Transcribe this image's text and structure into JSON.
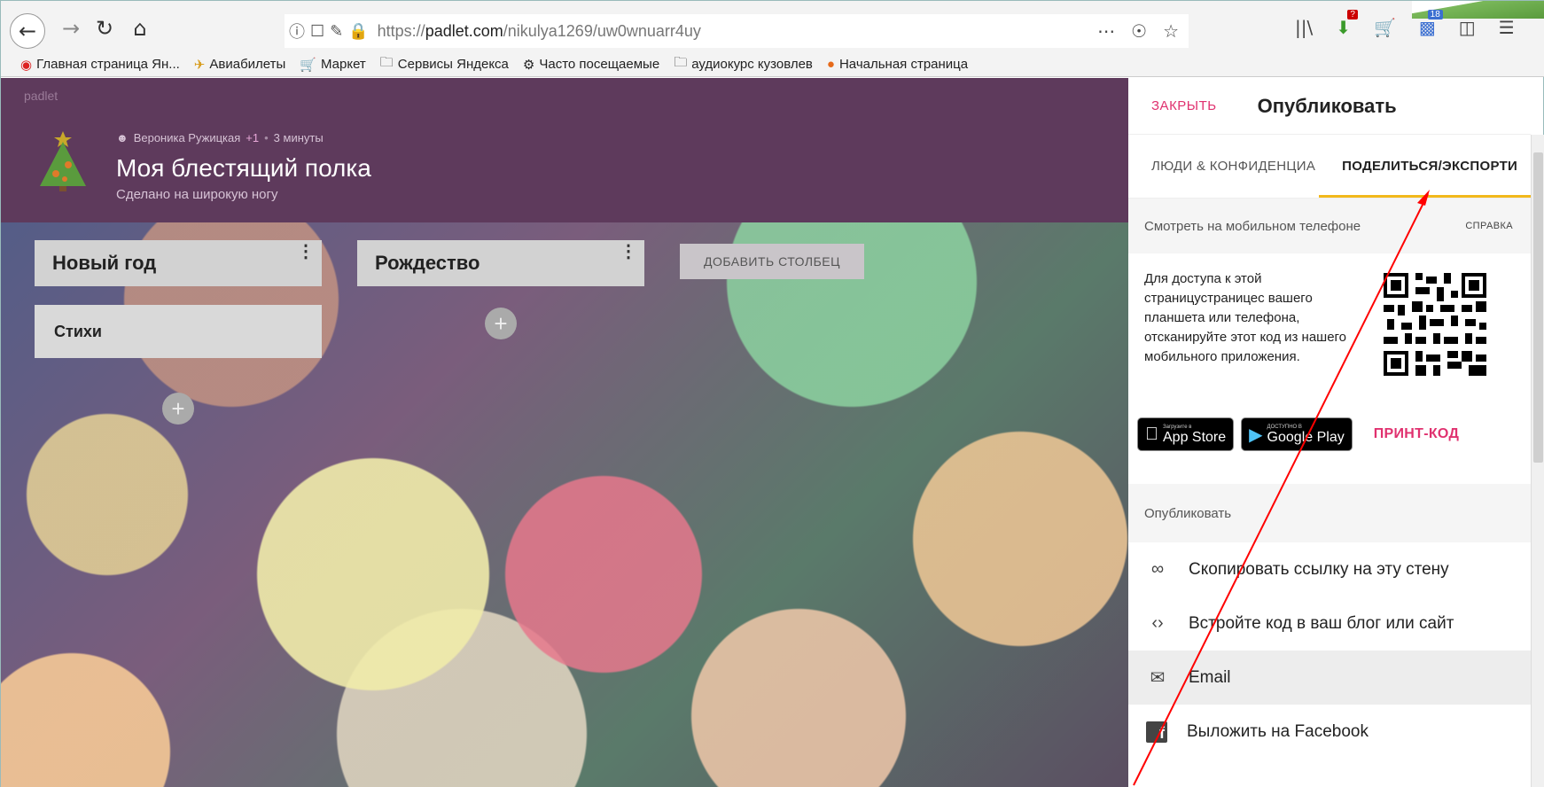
{
  "browser": {
    "url_prefix": "https://",
    "url_host": "padlet.com",
    "url_path": "/nikulya1269/uw0wnuarr4uy",
    "badges": {
      "download": "?",
      "notes": "18"
    },
    "icons": [
      "back-icon",
      "forward-icon",
      "reload-icon",
      "home-icon",
      "info-icon",
      "tracking-icon",
      "lock-icon",
      "more-icon",
      "pocket-icon",
      "star-icon",
      "library-icon",
      "download-icon",
      "cart-icon",
      "notes-icon",
      "sidebar-icon",
      "menu-icon"
    ]
  },
  "bookmarks": [
    {
      "label": "Главная страница Ян...",
      "icon": "yandex-icon"
    },
    {
      "label": "Авиабилеты",
      "icon": "plane-icon"
    },
    {
      "label": "Маркет",
      "icon": "cart-icon"
    },
    {
      "label": "Сервисы Яндекса",
      "icon": "folder-icon"
    },
    {
      "label": "Часто посещаемые",
      "icon": "gear-icon"
    },
    {
      "label": "аудиокурс кузовлев",
      "icon": "folder-icon"
    },
    {
      "label": "Начальная страница",
      "icon": "firefox-icon"
    }
  ],
  "padlet": {
    "logo": "padlet",
    "author": "Вероника Ружицкая",
    "plus": "+1",
    "time": "3 минуты",
    "title": "Моя блестящий полка",
    "subtitle": "Сделано на широкую ногу",
    "columns": [
      {
        "title": "Новый год"
      },
      {
        "title": "Рождество"
      }
    ],
    "add_column_label": "ДОБАВИТЬ СТОЛБЕЦ",
    "post_title": "Стихи",
    "plus_symbol": "+"
  },
  "panel": {
    "close_label": "ЗАКРЫТЬ",
    "title": "Опубликовать",
    "tabs": [
      {
        "label": "ЛЮДИ & КОНФИДЕНЦИА",
        "active": false
      },
      {
        "label": "ПОДЕЛИТЬСЯ/ЭКСПОРТИ",
        "active": true
      }
    ],
    "mobile_title": "Смотреть на мобильном телефоне",
    "help_label": "СПРАВКА",
    "mobile_text": "Для доступа к этой страницустраницес вашего планшета или телефона, отсканируйте этот код из нашего мобильного приложения.",
    "app_store_small": "Загрузите в",
    "app_store_big": "App Store",
    "google_play_small": "ДОСТУПНО В",
    "google_play_big": "Google Play",
    "print_code_label": "ПРИНТ-КОД",
    "publish_title": "Опубликовать",
    "actions": [
      {
        "label": "Скопировать ссылку на эту стену",
        "icon": "link-icon"
      },
      {
        "label": "Встройте код в ваш блог или сайт",
        "icon": "code-icon"
      },
      {
        "label": "Email",
        "icon": "email-icon"
      },
      {
        "label": "Выложить на Facebook",
        "icon": "facebook-icon"
      }
    ]
  },
  "colors": {
    "header": "#5e3a5c",
    "accent_pink": "#e0316f",
    "tab_underline": "#f2b81c",
    "annotation_arrow": "#ff0000"
  }
}
